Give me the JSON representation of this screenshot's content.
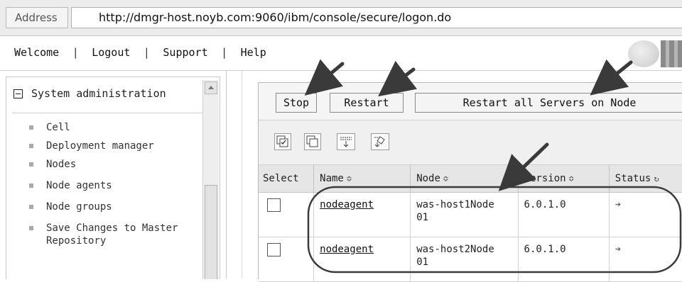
{
  "address_bar": {
    "label": "Address",
    "url": "http://dmgr-host.noyb.com:9060/ibm/console/secure/logon.do"
  },
  "top_nav": {
    "items": [
      "Welcome",
      "Logout",
      "Support",
      "Help"
    ],
    "separator": "|"
  },
  "left_nav": {
    "section_title": "System administration",
    "items": [
      "Cell",
      "Deployment manager",
      "Nodes",
      "Node agents",
      "Node groups",
      "Save Changes to Master Repository"
    ]
  },
  "content": {
    "buttons": {
      "stop": "Stop",
      "restart": "Restart",
      "restart_all": "Restart all Servers on Node"
    },
    "toolbar_icons": [
      "select-all-icon",
      "deselect-all-icon",
      "expand-icon",
      "filter-icon"
    ],
    "table": {
      "headers": [
        "Select",
        "Name",
        "Node",
        "Version",
        "Status"
      ],
      "rows": [
        {
          "name": "nodeagent",
          "node": "was-host1Node01",
          "version": "6.0.1.0",
          "status": "arrow"
        },
        {
          "name": "nodeagent",
          "node": "was-host2Node01",
          "version": "6.0.1.0",
          "status": "arrow"
        }
      ]
    }
  },
  "colors": {
    "annotation": "#3a3a3a"
  }
}
